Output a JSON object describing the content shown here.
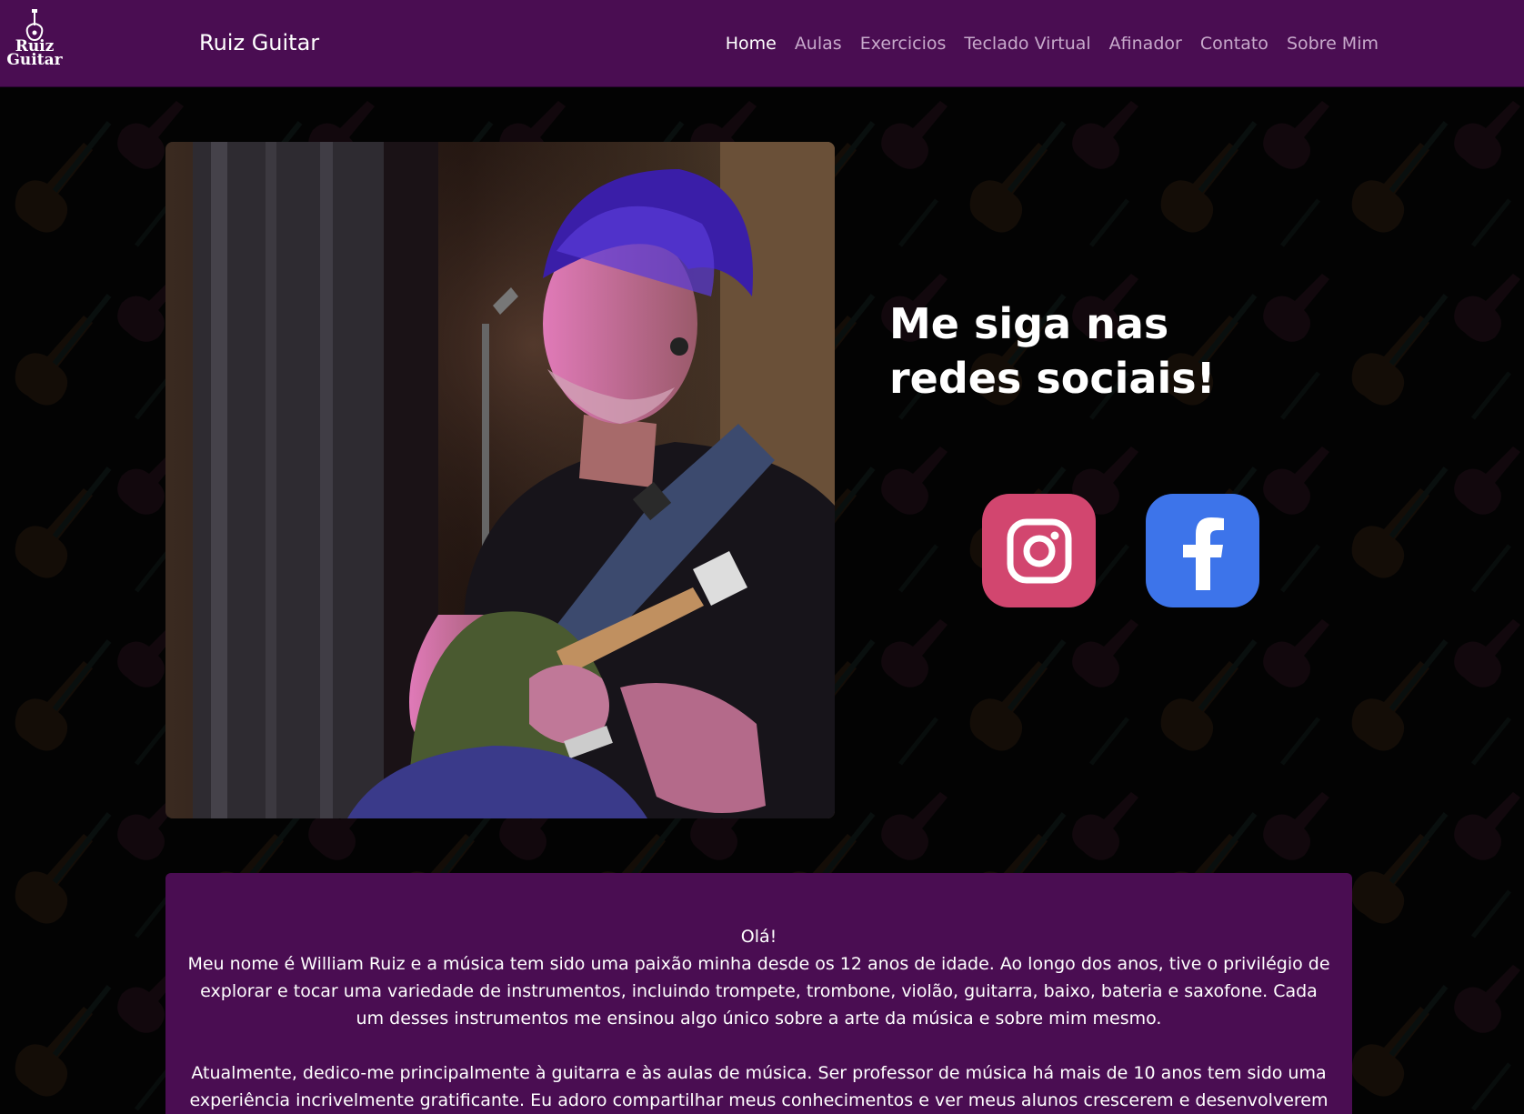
{
  "brand": {
    "logo_text_line1": "Ruiz",
    "logo_text_line2": "Guitar",
    "name": "Ruiz Guitar"
  },
  "nav": {
    "items": [
      {
        "label": "Home",
        "active": true
      },
      {
        "label": "Aulas",
        "active": false
      },
      {
        "label": "Exercicios",
        "active": false
      },
      {
        "label": "Teclado Virtual",
        "active": false
      },
      {
        "label": "Afinador",
        "active": false
      },
      {
        "label": "Contato",
        "active": false
      },
      {
        "label": "Sobre Mim",
        "active": false
      }
    ]
  },
  "hero": {
    "photo_icon": "guitarist-photo",
    "social_title": "Me siga nas redes sociais!",
    "social": [
      {
        "name": "instagram-icon",
        "color": "#d2466f"
      },
      {
        "name": "facebook-icon",
        "color": "#3d74ea"
      }
    ]
  },
  "about": {
    "greeting": "Olá!",
    "paragraph1": "Meu nome é William Ruiz e a música tem sido uma paixão minha desde os 12 anos de idade. Ao longo dos anos, tive o privilégio de explorar e tocar uma variedade de instrumentos, incluindo trompete, trombone, violão, guitarra, baixo, bateria e saxofone. Cada um desses instrumentos me ensinou algo único sobre a arte da música e sobre mim mesmo.",
    "paragraph2": "Atualmente, dedico-me principalmente à guitarra e às aulas de música. Ser professor de música há mais de 10 anos tem sido uma experiência incrivelmente gratificante. Eu adoro compartilhar meus conhecimentos e ver meus alunos crescerem e desenvolverem suas próprias paixões"
  },
  "colors": {
    "navbar": "#4a0d52",
    "background": "#030303",
    "instagram": "#d2466f",
    "facebook": "#3d74ea"
  }
}
